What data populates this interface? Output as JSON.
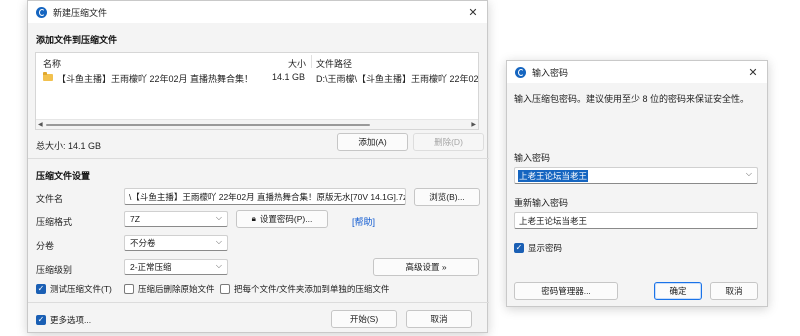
{
  "dialog": {
    "title": "新建压缩文件",
    "close_glyph": "✕",
    "add_section_title": "添加文件到压缩文件",
    "list": {
      "col_name": "名称",
      "col_size": "大小",
      "col_path": "文件路径",
      "rows": [
        {
          "name": "【斗鱼主播】王雨檬吖 22年02月 直播热舞合集！",
          "size": "14.1 GB",
          "path": "D:\\王雨檬\\【斗鱼主播】王雨檬吖 22年02月 直播"
        }
      ]
    },
    "total_size": "总大小: 14.1 GB",
    "add_button": "添加(A)",
    "delete_button": "删除(D)",
    "settings_title": "压缩文件设置",
    "filename_label": "文件名",
    "filename_value": "\\【斗鱼主播】王雨檬吖 22年02月 直播热舞合集！原版无水[70V 14.1G].7z",
    "browse_button": "浏览(B)...",
    "format_label": "压缩格式",
    "format_value": "7Z",
    "set_password_button": "设置密码(P)...",
    "help_link": "[帮助]",
    "split_label": "分卷",
    "split_value": "不分卷",
    "level_label": "压缩级别",
    "level_value": "2-正常压缩",
    "advanced_button": "高级设置 »",
    "test_checkbox": "测试压缩文件(T)",
    "delete_source_checkbox": "压缩后删除原始文件",
    "separate_checkbox": "把每个文件/文件夹添加到单独的压缩文件",
    "more_options_checkbox": "更多选项...",
    "start_button": "开始(S)",
    "cancel_button": "取消"
  },
  "password": {
    "title": "输入密码",
    "close_glyph": "✕",
    "description": "输入压缩包密码。建议使用至少 8 位的密码来保证安全性。",
    "enter_label": "输入密码",
    "enter_value": "上老王论坛当老王",
    "reenter_label": "重新输入密码",
    "reenter_value": "上老王论坛当老王",
    "show_password_checkbox": "显示密码",
    "manager_button": "密码管理器...",
    "ok_button": "确定",
    "cancel_button": "取消"
  }
}
